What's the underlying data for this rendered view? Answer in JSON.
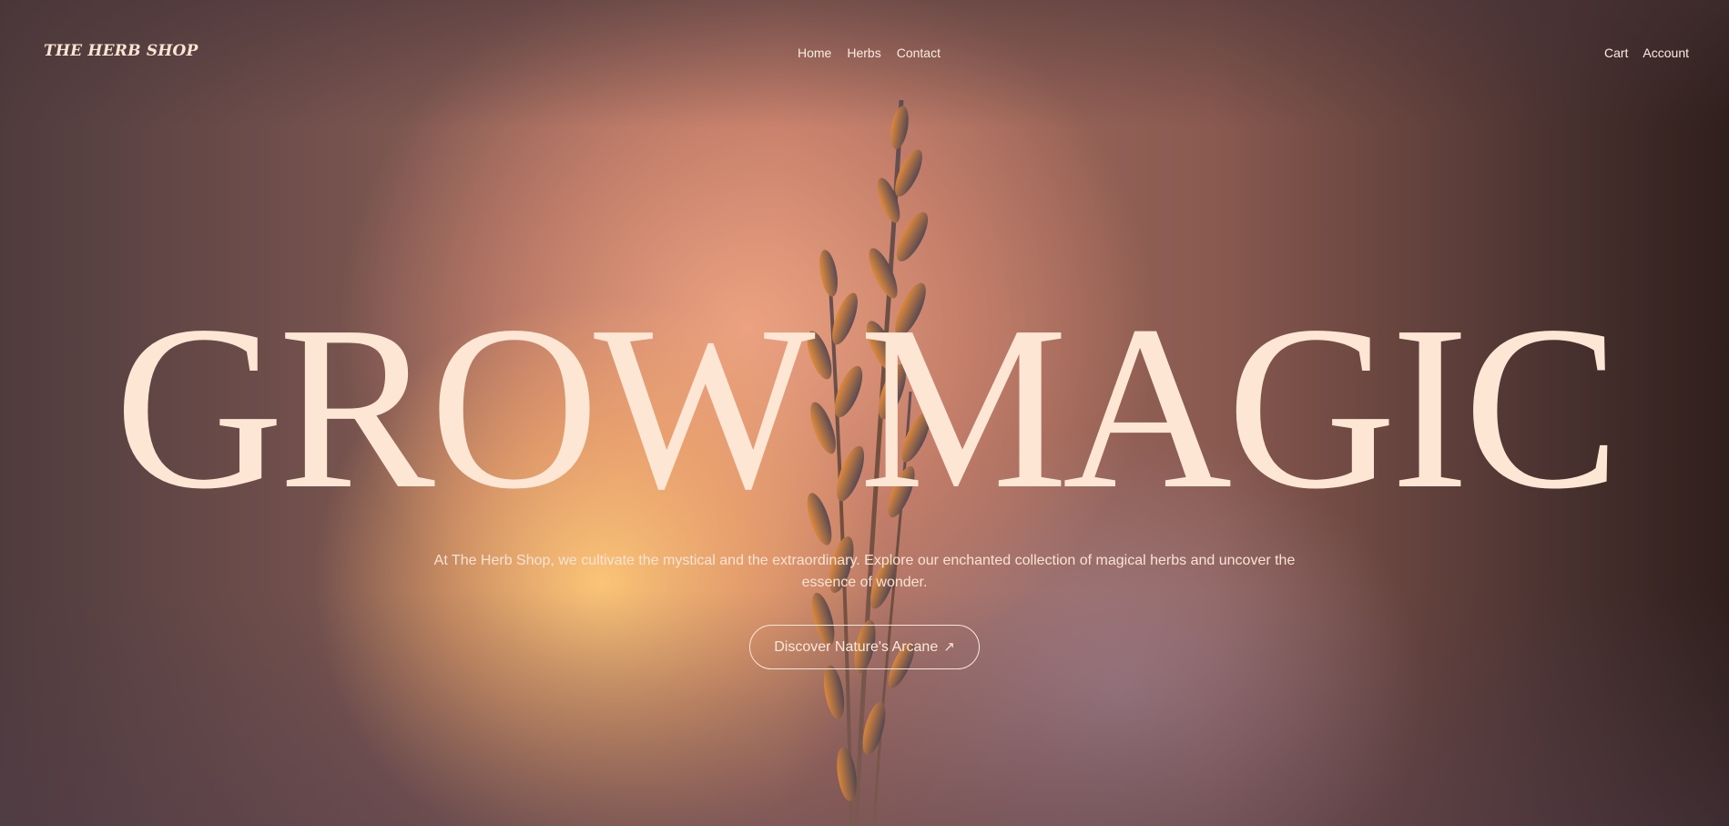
{
  "header": {
    "logo": "THE HERB SHOP",
    "nav": [
      {
        "label": "Home"
      },
      {
        "label": "Herbs"
      },
      {
        "label": "Contact"
      }
    ],
    "right_nav": [
      {
        "label": "Cart"
      },
      {
        "label": "Account"
      }
    ]
  },
  "hero": {
    "title": "GROW MAGIC",
    "description": "At The Herb Shop, we cultivate the mystical and the extraordinary. Explore our enchanted collection of magical herbs and uncover the essence of wonder.",
    "cta_label": "Discover Nature's Arcane",
    "cta_icon": "arrow-up-right-icon"
  },
  "colors": {
    "text_cream": "#fde6d4",
    "background_warm": "#a97062"
  }
}
